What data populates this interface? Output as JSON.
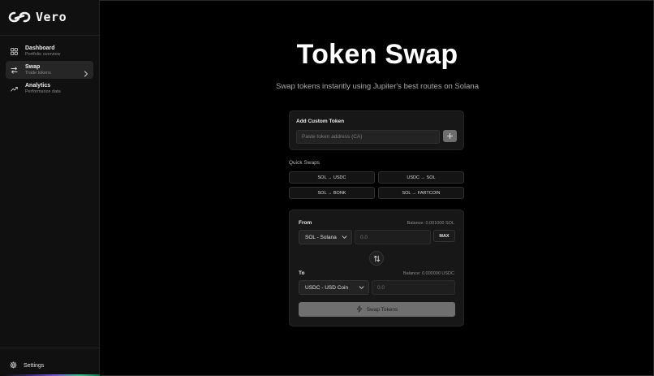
{
  "app": {
    "name": "Vero"
  },
  "sidebar": {
    "items": [
      {
        "label": "Dashboard",
        "sub": "Portfolio overview",
        "icon": "grid-icon",
        "active": false
      },
      {
        "label": "Swap",
        "sub": "Trade tokens",
        "icon": "swap-arrows-icon",
        "active": true
      },
      {
        "label": "Analytics",
        "sub": "Performance data",
        "icon": "trend-icon",
        "active": false
      }
    ],
    "settings_label": "Settings"
  },
  "main": {
    "title": "Token Swap",
    "subtitle": "Swap tokens instantly using Jupiter's best routes on Solana"
  },
  "custom_token": {
    "heading": "Add Custom Token",
    "placeholder": "Paste token address (CA)",
    "add_label": "+"
  },
  "quick_swaps": {
    "label": "Quick Swaps",
    "items": [
      "SOL → USDC",
      "USDC → SOL",
      "SOL → BONK",
      "SOL → FARTCOIN"
    ]
  },
  "swap": {
    "from_label": "From",
    "from_balance": "Balance: 0.001000 SOL",
    "from_token": "SOL - Solana",
    "from_amount_placeholder": "0.0",
    "max_label": "MAX",
    "to_label": "To",
    "to_balance": "Balance: 0.000000 USDC",
    "to_token": "USDC - USD Coin",
    "to_amount_placeholder": "0.0",
    "submit_label": "Swap Tokens"
  },
  "colors": {
    "background": "#000000",
    "sidebar": "#101010",
    "card": "#171717",
    "active_item": "#262626",
    "disabled_button": "#6f6f6f"
  }
}
